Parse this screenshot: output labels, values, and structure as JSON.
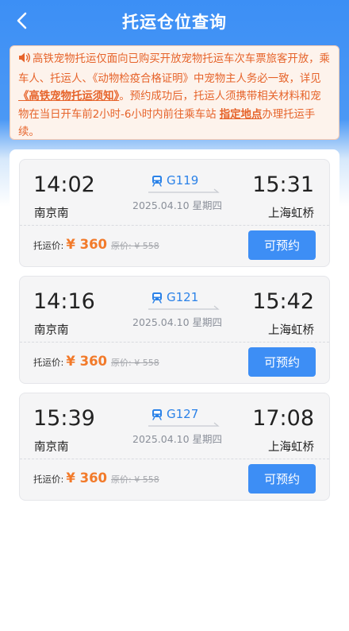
{
  "header": {
    "title": "托运仓位查询",
    "back_icon": "chevron-left-icon"
  },
  "notice": {
    "icon": "speaker-icon",
    "text_before": "高铁宠物托运仅面向已购买开放宠物托运车次车票旅客开放，乘车人、托运人、《动物检疫合格证明》中宠物主人务必一致，详见",
    "link1": "《高铁宠物托运须知》",
    "text_middle": "。预约成功后，托运人须携带相关材料和宠物在当日开车前2小时-6小时内前往乘车站 ",
    "link2": "指定地点",
    "text_after": "办理托运手续。"
  },
  "colors": {
    "primary": "#3d8ef5",
    "price": "#f27a2a",
    "notice_text": "#e6632a"
  },
  "trains": [
    {
      "dep_time": "14:02",
      "dep_station": "南京南",
      "train_no": "G119",
      "date": "2025.04.10 星期四",
      "arr_time": "15:31",
      "arr_station": "上海虹桥",
      "price_label": "托运价:",
      "price": "¥ 360",
      "orig_price": "原价: ¥ 558",
      "button": "可预约"
    },
    {
      "dep_time": "14:16",
      "dep_station": "南京南",
      "train_no": "G121",
      "date": "2025.04.10 星期四",
      "arr_time": "15:42",
      "arr_station": "上海虹桥",
      "price_label": "托运价:",
      "price": "¥ 360",
      "orig_price": "原价: ¥ 558",
      "button": "可预约"
    },
    {
      "dep_time": "15:39",
      "dep_station": "南京南",
      "train_no": "G127",
      "date": "2025.04.10 星期四",
      "arr_time": "17:08",
      "arr_station": "上海虹桥",
      "price_label": "托运价:",
      "price": "¥ 360",
      "orig_price": "原价: ¥ 558",
      "button": "可预约"
    }
  ]
}
